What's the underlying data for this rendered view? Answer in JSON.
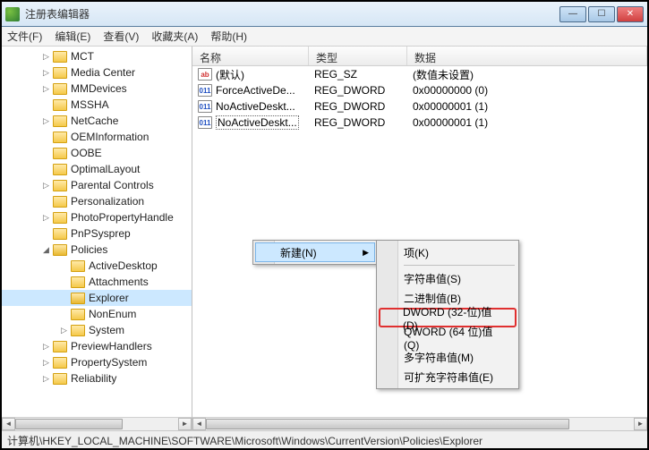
{
  "window": {
    "title": "注册表编辑器"
  },
  "menu": {
    "file": "文件(F)",
    "edit": "编辑(E)",
    "view": "查看(V)",
    "favorites": "收藏夹(A)",
    "help": "帮助(H)"
  },
  "tree": [
    {
      "indent": 44,
      "toggle": "▷",
      "label": "MCT"
    },
    {
      "indent": 44,
      "toggle": "▷",
      "label": "Media Center"
    },
    {
      "indent": 44,
      "toggle": "▷",
      "label": "MMDevices"
    },
    {
      "indent": 44,
      "toggle": "",
      "label": "MSSHA"
    },
    {
      "indent": 44,
      "toggle": "▷",
      "label": "NetCache"
    },
    {
      "indent": 44,
      "toggle": "",
      "label": "OEMInformation"
    },
    {
      "indent": 44,
      "toggle": "",
      "label": "OOBE"
    },
    {
      "indent": 44,
      "toggle": "",
      "label": "OptimalLayout"
    },
    {
      "indent": 44,
      "toggle": "▷",
      "label": "Parental Controls"
    },
    {
      "indent": 44,
      "toggle": "",
      "label": "Personalization"
    },
    {
      "indent": 44,
      "toggle": "▷",
      "label": "PhotoPropertyHandle"
    },
    {
      "indent": 44,
      "toggle": "",
      "label": "PnPSysprep"
    },
    {
      "indent": 44,
      "toggle": "◢",
      "label": "Policies",
      "open": true
    },
    {
      "indent": 64,
      "toggle": "",
      "label": "ActiveDesktop"
    },
    {
      "indent": 64,
      "toggle": "",
      "label": "Attachments"
    },
    {
      "indent": 64,
      "toggle": "",
      "label": "Explorer",
      "selected": true,
      "open": true
    },
    {
      "indent": 64,
      "toggle": "",
      "label": "NonEnum"
    },
    {
      "indent": 64,
      "toggle": "▷",
      "label": "System"
    },
    {
      "indent": 44,
      "toggle": "▷",
      "label": "PreviewHandlers"
    },
    {
      "indent": 44,
      "toggle": "▷",
      "label": "PropertySystem"
    },
    {
      "indent": 44,
      "toggle": "▷",
      "label": "Reliability"
    }
  ],
  "list": {
    "headers": {
      "name": "名称",
      "type": "类型",
      "data": "数据"
    },
    "rows": [
      {
        "icon": "str",
        "icon_text": "ab",
        "name": "(默认)",
        "type": "REG_SZ",
        "data": "(数值未设置)"
      },
      {
        "icon": "bin",
        "icon_text": "011",
        "name": "ForceActiveDe...",
        "type": "REG_DWORD",
        "data": "0x00000000 (0)"
      },
      {
        "icon": "bin",
        "icon_text": "011",
        "name": "NoActiveDeskt...",
        "type": "REG_DWORD",
        "data": "0x00000001 (1)"
      },
      {
        "icon": "bin",
        "icon_text": "011",
        "name": "NoActiveDeskt...",
        "type": "REG_DWORD",
        "data": "0x00000001 (1)",
        "editing": true
      }
    ]
  },
  "context_menu": {
    "parent": {
      "new": "新建(N)"
    },
    "sub": [
      {
        "label": "项(K)",
        "sep_after": true
      },
      {
        "label": "字符串值(S)"
      },
      {
        "label": "二进制值(B)"
      },
      {
        "label": "DWORD (32-位)值(D)",
        "highlight": true
      },
      {
        "label": "QWORD (64 位)值(Q)"
      },
      {
        "label": "多字符串值(M)"
      },
      {
        "label": "可扩充字符串值(E)"
      }
    ]
  },
  "statusbar": {
    "path": "计算机\\HKEY_LOCAL_MACHINE\\SOFTWARE\\Microsoft\\Windows\\CurrentVersion\\Policies\\Explorer"
  }
}
